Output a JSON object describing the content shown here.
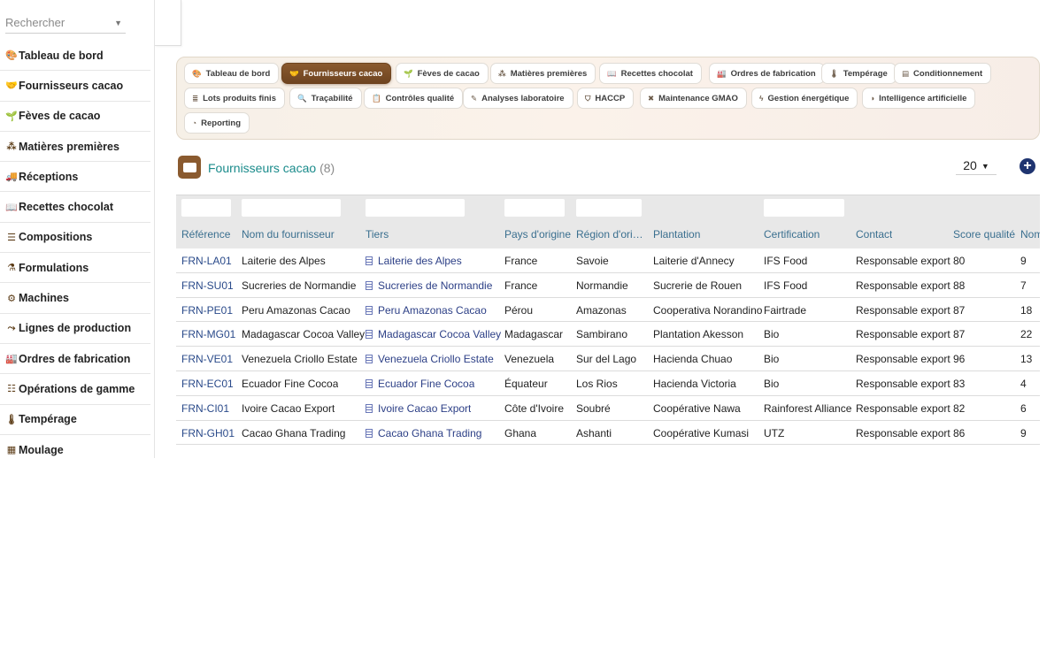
{
  "sidebar": {
    "search_placeholder": "Rechercher",
    "items": [
      {
        "label": "Tableau de bord",
        "icon": "palette-icon",
        "glyph": "🎨"
      },
      {
        "label": "Fournisseurs cacao",
        "icon": "handshake-icon",
        "glyph": "🤝"
      },
      {
        "label": "Fèves de cacao",
        "icon": "sprout-icon",
        "glyph": "🌱"
      },
      {
        "label": "Matières premières",
        "icon": "nodes-icon",
        "glyph": "⁂"
      },
      {
        "label": "Réceptions",
        "icon": "truck-icon",
        "glyph": "🚚"
      },
      {
        "label": "Recettes chocolat",
        "icon": "book-icon",
        "glyph": "📖"
      },
      {
        "label": "Compositions",
        "icon": "list-icon",
        "glyph": "☰"
      },
      {
        "label": "Formulations",
        "icon": "flask-icon",
        "glyph": "⚗"
      },
      {
        "label": "Machines",
        "icon": "gears-icon",
        "glyph": "⚙"
      },
      {
        "label": "Lignes de production",
        "icon": "route-icon",
        "glyph": "⤳"
      },
      {
        "label": "Ordres de fabrication",
        "icon": "industry-icon",
        "glyph": "🏭"
      },
      {
        "label": "Opérations de gamme",
        "icon": "tasks-icon",
        "glyph": "☷"
      },
      {
        "label": "Tempérage",
        "icon": "thermometer-icon",
        "glyph": "🌡"
      },
      {
        "label": "Moulage",
        "icon": "grid-icon",
        "glyph": "▦"
      }
    ]
  },
  "tabs": [
    {
      "label": "Tableau de bord",
      "glyph": "🎨"
    },
    {
      "label": "Fournisseurs cacao",
      "glyph": "🤝",
      "active": true
    },
    {
      "label": "Fèves de cacao",
      "glyph": "🌱"
    },
    {
      "label": "Matières premières",
      "glyph": "⁂"
    },
    {
      "label": "Recettes chocolat",
      "glyph": "📖"
    },
    {
      "label": "Ordres de fabrication",
      "glyph": "🏭"
    },
    {
      "label": "Tempérage",
      "glyph": "🌡"
    },
    {
      "label": "Conditionnement",
      "glyph": "▤"
    },
    {
      "label": "Lots produits finis",
      "glyph": "≣"
    },
    {
      "label": "Traçabilité",
      "glyph": "🔍"
    },
    {
      "label": "Contrôles qualité",
      "glyph": "📋"
    },
    {
      "label": "Analyses laboratoire",
      "glyph": "✎"
    },
    {
      "label": "HACCP",
      "glyph": "⛉"
    },
    {
      "label": "Maintenance GMAO",
      "glyph": "✖"
    },
    {
      "label": "Gestion énergétique",
      "glyph": "ϟ"
    },
    {
      "label": "Intelligence artificielle",
      "glyph": "◑"
    },
    {
      "label": "Reporting",
      "glyph": "◔"
    }
  ],
  "list": {
    "title": "Fournisseurs cacao",
    "count": "(8)",
    "per_page": "20"
  },
  "table": {
    "columns": [
      "Référence",
      "Nom du fournisseur",
      "Tiers",
      "Pays d'origine",
      "Région d'ori…",
      "Plantation",
      "Certification",
      "Contact",
      "Score qualité",
      "Nom"
    ],
    "rows": [
      [
        "FRN-LA01",
        "Laiterie des Alpes",
        "Laiterie des Alpes",
        "France",
        "Savoie",
        "Laiterie d'Annecy",
        "IFS Food",
        "Responsable export",
        "80",
        "9"
      ],
      [
        "FRN-SU01",
        "Sucreries de Normandie",
        "Sucreries de Normandie",
        "France",
        "Normandie",
        "Sucrerie de Rouen",
        "IFS Food",
        "Responsable export",
        "88",
        "7"
      ],
      [
        "FRN-PE01",
        "Peru Amazonas Cacao",
        "Peru Amazonas Cacao",
        "Pérou",
        "Amazonas",
        "Cooperativa Norandino",
        "Fairtrade",
        "Responsable export",
        "87",
        "18"
      ],
      [
        "FRN-MG01",
        "Madagascar Cocoa Valley",
        "Madagascar Cocoa Valley",
        "Madagascar",
        "Sambirano",
        "Plantation Akesson",
        "Bio",
        "Responsable export",
        "87",
        "22"
      ],
      [
        "FRN-VE01",
        "Venezuela Criollo Estate",
        "Venezuela Criollo Estate",
        "Venezuela",
        "Sur del Lago",
        "Hacienda Chuao",
        "Bio",
        "Responsable export",
        "96",
        "13"
      ],
      [
        "FRN-EC01",
        "Ecuador Fine Cocoa",
        "Ecuador Fine Cocoa",
        "Équateur",
        "Los Rios",
        "Hacienda Victoria",
        "Bio",
        "Responsable export",
        "83",
        "4"
      ],
      [
        "FRN-CI01",
        "Ivoire Cacao Export",
        "Ivoire Cacao Export",
        "Côte d'Ivoire",
        "Soubré",
        "Coopérative Nawa",
        "Rainforest Alliance",
        "Responsable export",
        "82",
        "6"
      ],
      [
        "FRN-GH01",
        "Cacao Ghana Trading",
        "Cacao Ghana Trading",
        "Ghana",
        "Ashanti",
        "Coopérative Kumasi",
        "UTZ",
        "Responsable export",
        "86",
        "9"
      ]
    ]
  }
}
